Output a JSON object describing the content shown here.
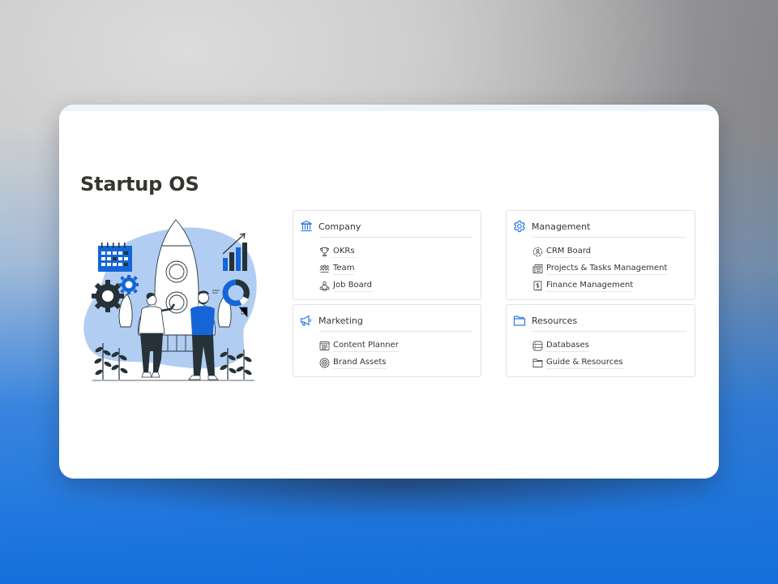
{
  "page": {
    "title": "Startup OS"
  },
  "theme": {
    "accent": "#2f7ae5",
    "text": "#37352f",
    "illustration_blue": "#1565d8",
    "illustration_light_blue": "#b2cdf2",
    "illustration_dark": "#263238"
  },
  "illustration": {
    "icon": "startup-rocket-illustration",
    "description": "Two people planning next to a rocket with calendar, gears and charts"
  },
  "sections": [
    {
      "title": "Company",
      "icon": "bank-icon",
      "items": [
        {
          "label": "OKRs",
          "icon": "trophy-icon"
        },
        {
          "label": "Team",
          "icon": "people-icon"
        },
        {
          "label": "Job Board",
          "icon": "network-icon"
        }
      ]
    },
    {
      "title": "Management",
      "icon": "gear-icon",
      "items": [
        {
          "label": "CRM Board",
          "icon": "customer-icon"
        },
        {
          "label": "Projects & Tasks Management",
          "icon": "newspaper-icon"
        },
        {
          "label": "Finance Management",
          "icon": "receipt-icon"
        }
      ]
    },
    {
      "title": "Marketing",
      "icon": "megaphone-icon",
      "items": [
        {
          "label": "Content Planner",
          "icon": "window-list-icon"
        },
        {
          "label": "Brand Assets",
          "icon": "target-icon"
        }
      ]
    },
    {
      "title": "Resources",
      "icon": "folder-icon",
      "items": [
        {
          "label": "Databases",
          "icon": "database-icon"
        },
        {
          "label": "Guide & Resources",
          "icon": "folder-outline-icon"
        }
      ]
    }
  ]
}
